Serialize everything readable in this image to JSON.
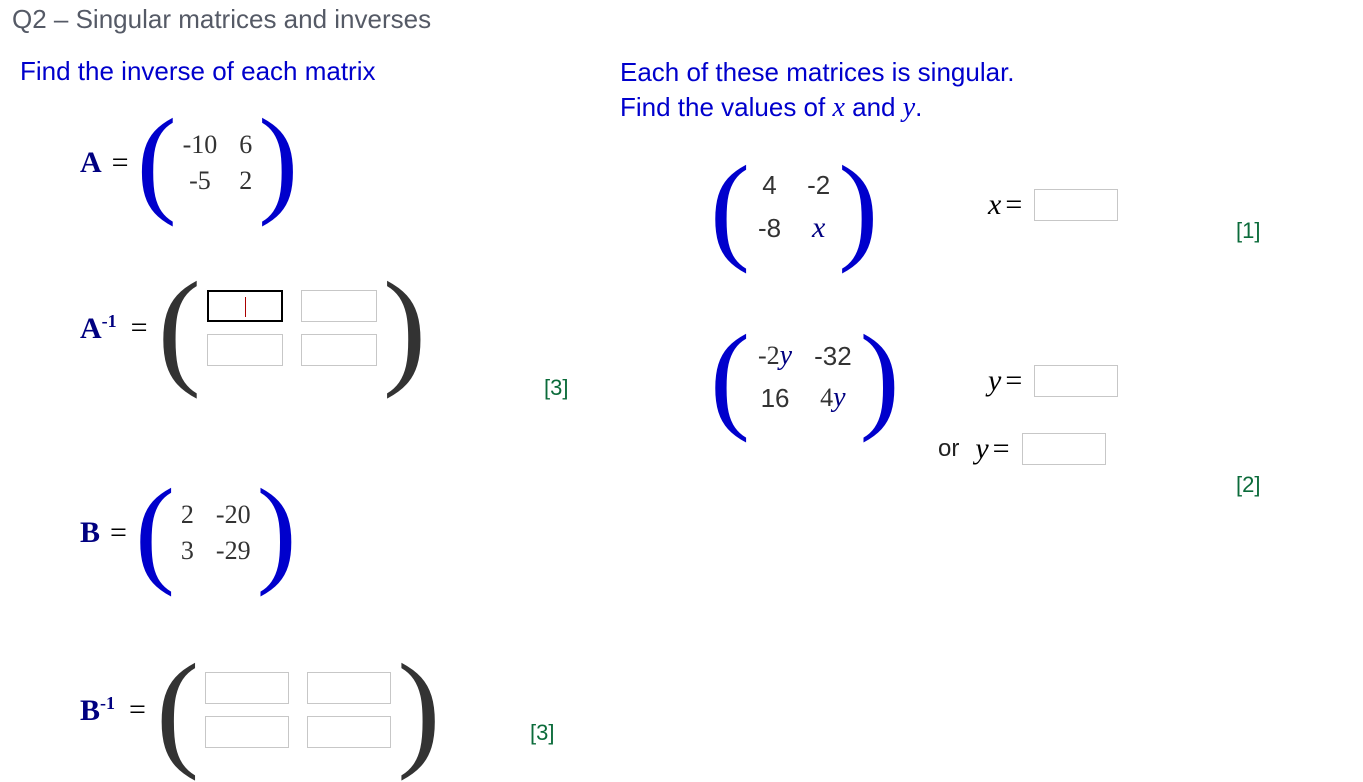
{
  "title": "Q2 – Singular matrices and inverses",
  "left": {
    "heading": "Find the inverse of each matrix",
    "A": {
      "label": "A",
      "eq": "=",
      "m": [
        [
          "-10",
          "6"
        ],
        [
          "-5",
          "2"
        ]
      ],
      "inv_label": "A",
      "inv_sup": "-1",
      "mark": "[3]"
    },
    "B": {
      "label": "B",
      "eq": "=",
      "m": [
        [
          "2",
          "-20"
        ],
        [
          "3",
          "-29"
        ]
      ],
      "inv_label": "B",
      "inv_sup": "-1",
      "mark": "[3]"
    }
  },
  "right": {
    "heading_l1": "Each of these matrices is singular.",
    "heading_l2_a": "Find the values of ",
    "heading_l2_x": "x",
    "heading_l2_b": " and ",
    "heading_l2_y": "y",
    "heading_l2_c": ".",
    "M1": {
      "m": [
        [
          "4",
          "-2"
        ],
        [
          "-8",
          "x"
        ]
      ],
      "ans_label_var": "x",
      "ans_eq": " =",
      "mark": "[1]"
    },
    "M2": {
      "m": [
        [
          "-2y",
          "-32"
        ],
        [
          "16",
          "4y"
        ]
      ],
      "ans1_label_var": "y",
      "ans1_eq": " =",
      "or": "or",
      "ans2_label_var": "y",
      "ans2_eq": " =",
      "mark": "[2]"
    }
  }
}
